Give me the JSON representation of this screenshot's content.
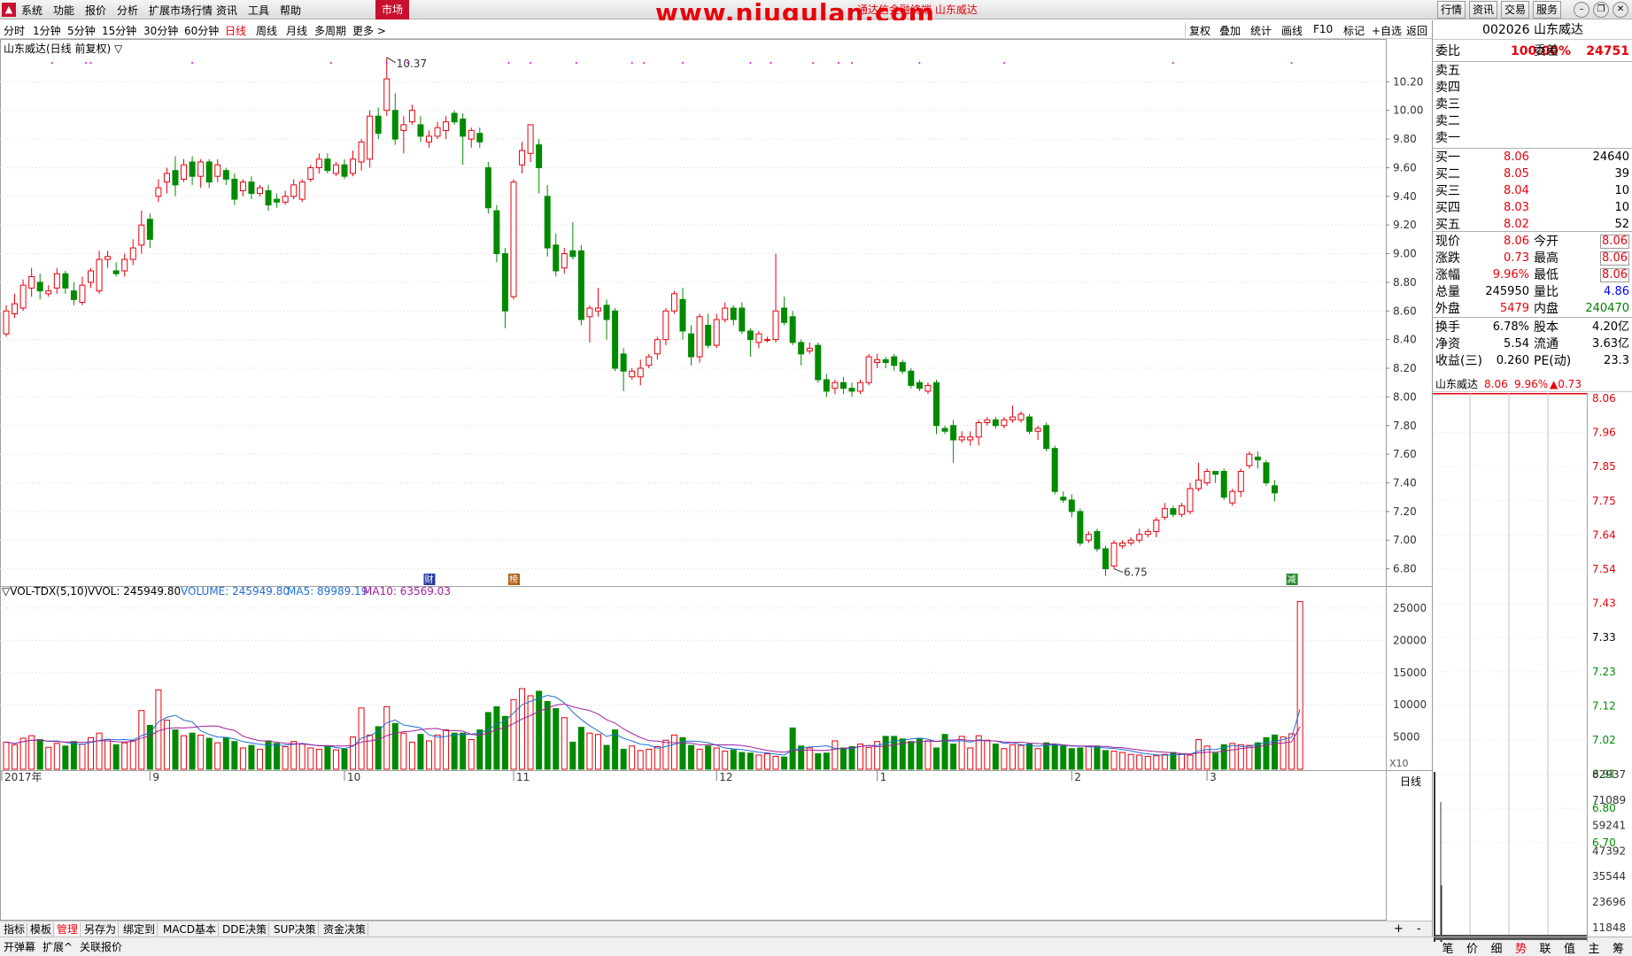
{
  "menu": [
    "系统",
    "功能",
    "报价",
    "分析",
    "扩展市场行情",
    "资讯",
    "工具",
    "帮助"
  ],
  "market_tab": "市场",
  "watermark": "www.niugulan.com",
  "subtitle": "通达信金融终端 山东威达",
  "right_buttons": [
    "行情",
    "资讯",
    "交易",
    "服务"
  ],
  "periods": [
    "分时",
    "1分钟",
    "5分钟",
    "15分钟",
    "30分钟",
    "60分钟",
    "日线",
    "周线",
    "月线",
    "多周期",
    "更多 >"
  ],
  "active_period": "日线",
  "right_tools": [
    "复权",
    "叠加",
    "统计",
    "画线",
    "F10",
    "标记",
    "+自选",
    "返回"
  ],
  "chart_title": "山东威达(日线 前复权) ▽",
  "colors": {
    "up": "#e8000b",
    "down": "#008a00",
    "ma5": "#1f6fd6",
    "ma10": "#a0209c",
    "grid": "#d8d8d8"
  },
  "chart_data": {
    "type": "candlestick",
    "y_ticks": [
      "10.20",
      "10.00",
      "9.80",
      "9.60",
      "9.40",
      "9.20",
      "9.00",
      "8.80",
      "8.60",
      "8.40",
      "8.20",
      "8.00",
      "7.80",
      "7.60",
      "7.40",
      "7.20",
      "7.00",
      "6.80"
    ],
    "ylim": [
      6.68,
      10.4
    ],
    "x_labels": [
      "2017年",
      "9",
      "10",
      "11",
      "12",
      "1",
      "2",
      "3"
    ],
    "x_label_index": [
      0,
      17,
      40,
      60,
      84,
      103,
      126,
      142
    ],
    "high_label": "10.37",
    "low_label": "6.75",
    "high_index": 45,
    "low_index": 131,
    "event_markers": [
      {
        "index": 50,
        "text": "财"
      },
      {
        "index": 60,
        "text": "榜"
      },
      {
        "index": 152,
        "text": "减"
      }
    ],
    "ohlc": [
      [
        8.44,
        8.6,
        8.42,
        8.64
      ],
      [
        8.58,
        8.65,
        8.55,
        8.72
      ],
      [
        8.62,
        8.78,
        8.6,
        8.82
      ],
      [
        8.76,
        8.84,
        8.7,
        8.9
      ],
      [
        8.8,
        8.74,
        8.68,
        8.86
      ],
      [
        8.72,
        8.74,
        8.7,
        8.78
      ],
      [
        8.76,
        8.86,
        8.72,
        8.9
      ],
      [
        8.86,
        8.76,
        8.72,
        8.88
      ],
      [
        8.74,
        8.68,
        8.64,
        8.8
      ],
      [
        8.66,
        8.78,
        8.64,
        8.84
      ],
      [
        8.8,
        8.88,
        8.76,
        8.9
      ],
      [
        8.74,
        8.96,
        8.72,
        9.02
      ],
      [
        8.96,
        8.98,
        8.9,
        9.02
      ],
      [
        8.88,
        8.86,
        8.84,
        8.94
      ],
      [
        8.88,
        8.96,
        8.84,
        9.0
      ],
      [
        8.96,
        9.04,
        8.92,
        9.1
      ],
      [
        9.06,
        9.2,
        9.0,
        9.3
      ],
      [
        9.24,
        9.1,
        9.04,
        9.28
      ],
      [
        9.4,
        9.46,
        9.36,
        9.52
      ],
      [
        9.5,
        9.56,
        9.42,
        9.6
      ],
      [
        9.58,
        9.48,
        9.4,
        9.68
      ],
      [
        9.52,
        9.62,
        9.5,
        9.66
      ],
      [
        9.64,
        9.54,
        9.48,
        9.68
      ],
      [
        9.54,
        9.64,
        9.46,
        9.66
      ],
      [
        9.64,
        9.5,
        9.46,
        9.66
      ],
      [
        9.54,
        9.62,
        9.5,
        9.66
      ],
      [
        9.58,
        9.52,
        9.48,
        9.6
      ],
      [
        9.52,
        9.38,
        9.34,
        9.56
      ],
      [
        9.44,
        9.5,
        9.4,
        9.52
      ],
      [
        9.5,
        9.42,
        9.38,
        9.54
      ],
      [
        9.42,
        9.46,
        9.4,
        9.48
      ],
      [
        9.44,
        9.34,
        9.3,
        9.48
      ],
      [
        9.38,
        9.36,
        9.32,
        9.42
      ],
      [
        9.36,
        9.4,
        9.34,
        9.44
      ],
      [
        9.4,
        9.48,
        9.38,
        9.52
      ],
      [
        9.38,
        9.5,
        9.36,
        9.52
      ],
      [
        9.52,
        9.6,
        9.5,
        9.62
      ],
      [
        9.6,
        9.66,
        9.56,
        9.7
      ],
      [
        9.66,
        9.58,
        9.56,
        9.7
      ],
      [
        9.56,
        9.62,
        9.54,
        9.64
      ],
      [
        9.62,
        9.54,
        9.52,
        9.66
      ],
      [
        9.56,
        9.66,
        9.54,
        9.72
      ],
      [
        9.64,
        9.78,
        9.58,
        9.8
      ],
      [
        9.66,
        9.96,
        9.6,
        10.0
      ],
      [
        9.96,
        9.84,
        9.8,
        10.02
      ],
      [
        10.0,
        10.22,
        9.96,
        10.37
      ],
      [
        10.0,
        9.8,
        9.76,
        10.12
      ],
      [
        9.86,
        9.9,
        9.7,
        9.96
      ],
      [
        9.92,
        10.0,
        9.9,
        10.04
      ],
      [
        9.9,
        9.82,
        9.78,
        9.96
      ],
      [
        9.78,
        9.82,
        9.74,
        9.86
      ],
      [
        9.82,
        9.88,
        9.8,
        9.92
      ],
      [
        9.86,
        9.92,
        9.8,
        9.96
      ],
      [
        9.98,
        9.92,
        9.9,
        10.0
      ],
      [
        9.94,
        9.82,
        9.62,
        9.98
      ],
      [
        9.8,
        9.86,
        9.74,
        9.88
      ],
      [
        9.84,
        9.78,
        9.74,
        9.88
      ],
      [
        9.6,
        9.32,
        9.28,
        9.64
      ],
      [
        9.3,
        9.0,
        8.94,
        9.34
      ],
      [
        9.0,
        8.6,
        8.48,
        9.04
      ],
      [
        8.7,
        9.5,
        8.68,
        9.52
      ],
      [
        9.62,
        9.72,
        9.56,
        9.78
      ],
      [
        9.7,
        9.9,
        9.64,
        9.9
      ],
      [
        9.76,
        9.6,
        9.42,
        9.8
      ],
      [
        9.4,
        9.04,
        8.98,
        9.48
      ],
      [
        9.06,
        8.88,
        8.84,
        9.14
      ],
      [
        8.9,
        9.0,
        8.86,
        9.04
      ],
      [
        9.02,
        8.98,
        8.96,
        9.22
      ],
      [
        9.02,
        8.54,
        8.5,
        9.06
      ],
      [
        8.56,
        8.62,
        8.38,
        8.64
      ],
      [
        8.6,
        8.62,
        8.56,
        8.76
      ],
      [
        8.64,
        8.54,
        8.4,
        8.68
      ],
      [
        8.6,
        8.2,
        8.18,
        8.62
      ],
      [
        8.3,
        8.18,
        8.04,
        8.34
      ],
      [
        8.14,
        8.18,
        8.12,
        8.2
      ],
      [
        8.14,
        8.2,
        8.08,
        8.26
      ],
      [
        8.22,
        8.28,
        8.2,
        8.3
      ],
      [
        8.3,
        8.4,
        8.26,
        8.42
      ],
      [
        8.4,
        8.6,
        8.36,
        8.62
      ],
      [
        8.6,
        8.72,
        8.58,
        8.74
      ],
      [
        8.68,
        8.46,
        8.4,
        8.76
      ],
      [
        8.44,
        8.28,
        8.22,
        8.5
      ],
      [
        8.28,
        8.56,
        8.24,
        8.58
      ],
      [
        8.5,
        8.36,
        8.34,
        8.58
      ],
      [
        8.36,
        8.54,
        8.34,
        8.58
      ],
      [
        8.54,
        8.62,
        8.52,
        8.66
      ],
      [
        8.62,
        8.54,
        8.5,
        8.64
      ],
      [
        8.62,
        8.46,
        8.44,
        8.66
      ],
      [
        8.46,
        8.4,
        8.28,
        8.48
      ],
      [
        8.38,
        8.44,
        8.34,
        8.46
      ],
      [
        8.4,
        8.4,
        8.38,
        8.42
      ],
      [
        8.4,
        8.6,
        8.38,
        9.0
      ],
      [
        8.62,
        8.52,
        8.5,
        8.7
      ],
      [
        8.56,
        8.38,
        8.36,
        8.6
      ],
      [
        8.38,
        8.3,
        8.22,
        8.4
      ],
      [
        8.32,
        8.34,
        8.3,
        8.38
      ],
      [
        8.36,
        8.12,
        8.1,
        8.38
      ],
      [
        8.12,
        8.04,
        8.0,
        8.16
      ],
      [
        8.06,
        8.1,
        8.02,
        8.12
      ],
      [
        8.1,
        8.06,
        8.02,
        8.14
      ],
      [
        8.06,
        8.04,
        8.0,
        8.1
      ],
      [
        8.04,
        8.1,
        8.02,
        8.12
      ],
      [
        8.1,
        8.28,
        8.08,
        8.3
      ],
      [
        8.24,
        8.26,
        8.2,
        8.3
      ],
      [
        8.26,
        8.24,
        8.2,
        8.28
      ],
      [
        8.28,
        8.22,
        8.18,
        8.3
      ],
      [
        8.24,
        8.18,
        8.16,
        8.26
      ],
      [
        8.18,
        8.08,
        8.06,
        8.2
      ],
      [
        8.1,
        8.06,
        8.04,
        8.12
      ],
      [
        8.04,
        8.08,
        8.02,
        8.1
      ],
      [
        8.1,
        7.8,
        7.74,
        8.12
      ],
      [
        7.78,
        7.76,
        7.74,
        7.8
      ],
      [
        7.8,
        7.7,
        7.54,
        7.84
      ],
      [
        7.7,
        7.72,
        7.68,
        7.76
      ],
      [
        7.7,
        7.72,
        7.66,
        7.76
      ],
      [
        7.72,
        7.82,
        7.66,
        7.84
      ],
      [
        7.82,
        7.84,
        7.8,
        7.86
      ],
      [
        7.84,
        7.8,
        7.78,
        7.86
      ],
      [
        7.8,
        7.84,
        7.78,
        7.86
      ],
      [
        7.84,
        7.86,
        7.82,
        7.94
      ],
      [
        7.84,
        7.88,
        7.82,
        7.9
      ],
      [
        7.86,
        7.76,
        7.74,
        7.88
      ],
      [
        7.76,
        7.78,
        7.7,
        7.8
      ],
      [
        7.8,
        7.64,
        7.62,
        7.82
      ],
      [
        7.64,
        7.34,
        7.32,
        7.66
      ],
      [
        7.3,
        7.28,
        7.26,
        7.34
      ],
      [
        7.28,
        7.2,
        7.16,
        7.32
      ],
      [
        7.2,
        6.98,
        6.96,
        7.22
      ],
      [
        7.0,
        7.04,
        6.98,
        7.06
      ],
      [
        7.06,
        6.94,
        6.92,
        7.08
      ],
      [
        6.94,
        6.8,
        6.75,
        6.96
      ],
      [
        6.82,
        6.98,
        6.8,
        7.0
      ],
      [
        6.96,
        6.98,
        6.94,
        7.0
      ],
      [
        6.98,
        7.0,
        6.96,
        7.02
      ],
      [
        7.0,
        7.04,
        6.98,
        7.08
      ],
      [
        7.04,
        7.06,
        7.02,
        7.08
      ],
      [
        7.06,
        7.14,
        7.02,
        7.16
      ],
      [
        7.16,
        7.22,
        7.14,
        7.26
      ],
      [
        7.22,
        7.18,
        7.16,
        7.24
      ],
      [
        7.18,
        7.24,
        7.16,
        7.26
      ],
      [
        7.2,
        7.36,
        7.18,
        7.4
      ],
      [
        7.36,
        7.42,
        7.34,
        7.54
      ],
      [
        7.4,
        7.48,
        7.38,
        7.5
      ],
      [
        7.48,
        7.46,
        7.4,
        7.48
      ],
      [
        7.48,
        7.3,
        7.28,
        7.5
      ],
      [
        7.26,
        7.34,
        7.24,
        7.36
      ],
      [
        7.34,
        7.48,
        7.3,
        7.5
      ],
      [
        7.52,
        7.6,
        7.5,
        7.62
      ],
      [
        7.58,
        7.56,
        7.5,
        7.62
      ],
      [
        7.54,
        7.4,
        7.38,
        7.56
      ],
      [
        7.38,
        7.33,
        7.27,
        7.42
      ]
    ],
    "vol_ticks": [
      "25000",
      "20000",
      "15000",
      "10000",
      "5000"
    ],
    "vol_max": 26500,
    "volume": [
      4200,
      3800,
      4800,
      5200,
      4600,
      3400,
      4000,
      3600,
      4300,
      3900,
      4900,
      5600,
      4600,
      3800,
      4100,
      4400,
      9100,
      6800,
      12300,
      7600,
      6100,
      5200,
      5600,
      5300,
      4800,
      4100,
      4900,
      4300,
      3300,
      3700,
      3100,
      4400,
      4000,
      3500,
      4300,
      3900,
      3300,
      3100,
      3500,
      3000,
      3100,
      5000,
      9500,
      5300,
      6600,
      9700,
      7100,
      5600,
      4200,
      5400,
      4400,
      5300,
      6100,
      5600,
      5600,
      4600,
      6100,
      8800,
      9700,
      8200,
      10800,
      12500,
      11400,
      12100,
      10500,
      9400,
      8000,
      4200,
      6500,
      5600,
      5400,
      3700,
      6100,
      3100,
      3600,
      2900,
      3100,
      3500,
      4500,
      5300,
      4900,
      3700,
      3100,
      3600,
      3300,
      2800,
      3000,
      2600,
      2500,
      2200,
      2400,
      2000,
      1900,
      6400,
      3600,
      3300,
      2400,
      2500,
      4400,
      3300,
      3500,
      3900,
      3400,
      4300,
      5100,
      5100,
      4700,
      4300,
      4800,
      4400,
      3300,
      5400,
      3900,
      5100,
      3300,
      5200,
      4500,
      3900,
      3200,
      3800,
      3700,
      3900,
      3200,
      4100,
      3800,
      3600,
      3200,
      3300,
      3500,
      3600,
      2900,
      2800,
      2600,
      2300,
      2200,
      2000,
      2100,
      2300,
      2600,
      2400,
      2200,
      4600,
      3600,
      2500,
      3800,
      4000,
      3800,
      3700,
      4100,
      4900,
      5300,
      5000,
      5500,
      26000
    ],
    "vol_labels": {
      "indicator": "▽VOL-TDX(5,10)",
      "vvol": "VVOL: 245949.80",
      "volume": "VOLUME: 245949.80",
      "ma5": "MA5: 89989.19",
      "ma10": "MA10: 63569.03"
    },
    "vol_unit": "X10",
    "period_label": "日线"
  },
  "bottom_tabs": [
    "指标",
    "模板",
    "管理",
    "另存为",
    "绑定到",
    "MACD基本",
    "DDE决策",
    "SUP决策",
    "资金决策"
  ],
  "active_bottom_tab": "管理",
  "status": [
    "开弹幕",
    "扩展^",
    "关联报价"
  ],
  "quote": {
    "code_name": "002026 山东威达",
    "weibi_label": "委比",
    "weibi": "100.00%",
    "weicha_label": "委差",
    "weicha": "24751",
    "asks": [
      "卖五",
      "卖四",
      "卖三",
      "卖二",
      "卖一"
    ],
    "bids": [
      {
        "label": "买一",
        "price": "8.06",
        "vol": "24640"
      },
      {
        "label": "买二",
        "price": "8.05",
        "vol": "39"
      },
      {
        "label": "买三",
        "price": "8.04",
        "vol": "10"
      },
      {
        "label": "买四",
        "price": "8.03",
        "vol": "10"
      },
      {
        "label": "买五",
        "price": "8.02",
        "vol": "52"
      }
    ],
    "stats": [
      {
        "l1": "现价",
        "v1": "8.06",
        "c1": "red",
        "l2": "今开",
        "v2": "8.06",
        "c2": "red"
      },
      {
        "l1": "涨跌",
        "v1": "0.73",
        "c1": "red",
        "l2": "最高",
        "v2": "8.06",
        "c2": "red"
      },
      {
        "l1": "涨幅",
        "v1": "9.96%",
        "c1": "red",
        "l2": "最低",
        "v2": "8.06",
        "c2": "red"
      },
      {
        "l1": "总量",
        "v1": "245950",
        "c1": "",
        "l2": "量比",
        "v2": "4.86",
        "c2": "blue"
      },
      {
        "l1": "外盘",
        "v1": "5479",
        "c1": "red",
        "l2": "内盘",
        "v2": "240470",
        "c2": "green"
      }
    ],
    "stats2": [
      {
        "l1": "换手",
        "v1": "6.78%",
        "l2": "股本",
        "v2": "4.20亿"
      },
      {
        "l1": "净资",
        "v1": "5.54",
        "l2": "流通",
        "v2": "3.63亿"
      },
      {
        "l1": "收益(三)",
        "v1": "0.260",
        "l2": "PE(动)",
        "v2": "23.3"
      }
    ],
    "mini": {
      "name": "山东威达",
      "price": "8.06",
      "pct": "9.96%",
      "chg": "▲0.73",
      "price_ticks": [
        "8.06",
        "7.96",
        "7.85",
        "7.75",
        "7.64",
        "7.54",
        "7.43",
        "7.33",
        "7.23",
        "7.12",
        "7.02",
        "6.91",
        "6.80",
        "6.70"
      ],
      "vol_ticks": [
        "82937",
        "71089",
        "59241",
        "47392",
        "35544",
        "23696",
        "11848"
      ]
    },
    "side_tabs": [
      "笔",
      "价",
      "细",
      "势",
      "联",
      "值",
      "主",
      "筹"
    ],
    "active_side_tab": "势"
  }
}
